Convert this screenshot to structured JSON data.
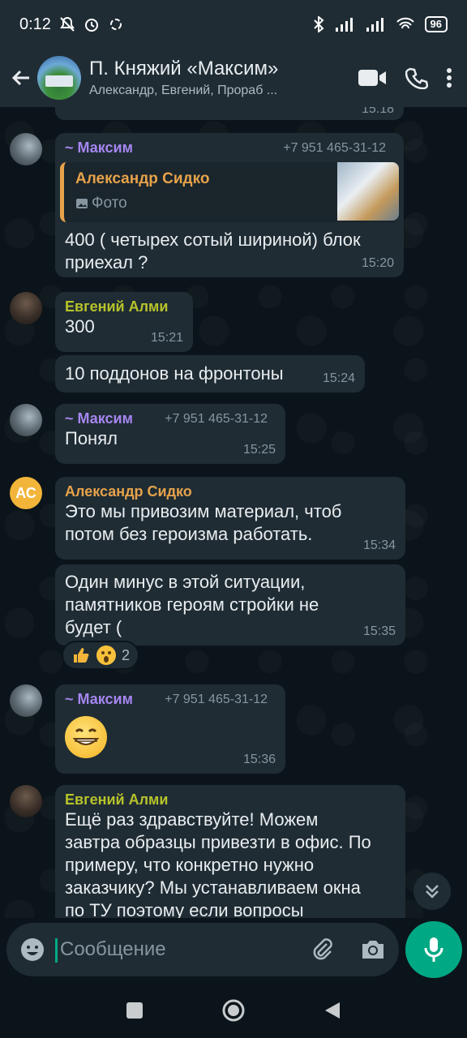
{
  "status": {
    "time": "0:12",
    "battery": "96"
  },
  "header": {
    "title": "П. Княжий «Максим»",
    "subtitle": "Александр, Евгений, Прораб ..."
  },
  "messages": {
    "top_time": "15:18",
    "m1": {
      "author": "~ Максим",
      "phone": "+7 951 465-31-12",
      "quote_author": "Александр Сидко",
      "quote_type": "Фото",
      "text": "400 ( четырех сотый шириной) блок приехал ?",
      "time": "15:20"
    },
    "m2": {
      "author": "Евгений Алми",
      "text": "300",
      "time": "15:21"
    },
    "m3": {
      "text": "10 поддонов на фронтоны",
      "time": "15:24"
    },
    "m4": {
      "author": "~ Максим",
      "phone": "+7 951 465-31-12",
      "text": "Понял",
      "time": "15:25"
    },
    "m5": {
      "avatar_initials": "АС",
      "author": "Александр Сидко",
      "text": "Это мы привозим материал, чтоб потом без героизма работать.",
      "time": "15:34"
    },
    "m6": {
      "text": "Один минус в этой ситуации, памятников героям стройки не будет  (",
      "time": "15:35",
      "reaction_count": "2"
    },
    "m7": {
      "author": "~ Максим",
      "phone": "+7 951 465-31-12",
      "time": "15:36"
    },
    "m8": {
      "author": "Евгений Алми",
      "text": "Ещё раз здравствуйте! Можем завтра образцы привезти в офис. По примеру, что конкретно нужно заказчику? Мы устанавливаем окна по ТУ поэтому если вопросы"
    }
  },
  "composer": {
    "placeholder": "Сообщение"
  },
  "icons": {
    "back": "arrow-left-icon",
    "video": "video-call-icon",
    "call": "phone-icon",
    "menu": "more-vert-icon",
    "emoji": "emoji-icon",
    "attach": "paperclip-icon",
    "camera": "camera-icon",
    "mic": "mic-icon"
  },
  "colors": {
    "accent": "#00a884",
    "maksim": "#a686f0",
    "alex": "#e7a24a",
    "evgeniy": "#b7c32a"
  }
}
